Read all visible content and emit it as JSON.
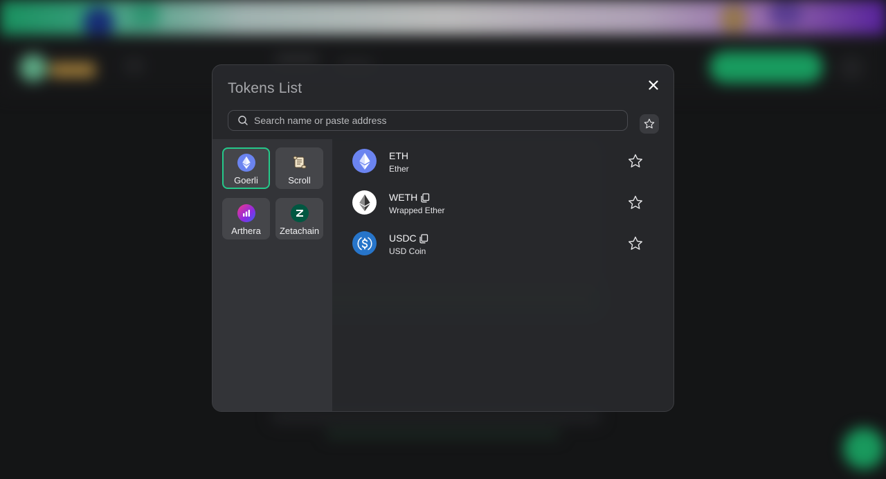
{
  "modal": {
    "title": "Tokens List",
    "search": {
      "placeholder": "Search name or paste address",
      "value": ""
    }
  },
  "chains": [
    {
      "label": "Goerli",
      "icon": "ethereum-icon",
      "selected": true
    },
    {
      "label": "Scroll",
      "icon": "scroll-icon",
      "selected": false
    },
    {
      "label": "Arthera",
      "icon": "arthera-icon",
      "selected": false
    },
    {
      "label": "Zetachain",
      "icon": "zetachain-icon",
      "selected": false
    }
  ],
  "tokens": [
    {
      "symbol": "ETH",
      "name": "Ether",
      "icon": "ethereum-icon",
      "copyable": false,
      "favorite": false
    },
    {
      "symbol": "WETH",
      "name": "Wrapped Ether",
      "icon": "weth-icon",
      "copyable": true,
      "favorite": false
    },
    {
      "symbol": "USDC",
      "name": "USD Coin",
      "icon": "usdc-icon",
      "copyable": true,
      "favorite": false
    }
  ],
  "colors": {
    "accent": "#25c98a",
    "modal_bg": "#28292c",
    "panel_bg": "#333438",
    "chain_btn_bg": "#45464a",
    "eth_blue": "#6b84f0",
    "usdc_blue": "#2775ca"
  }
}
